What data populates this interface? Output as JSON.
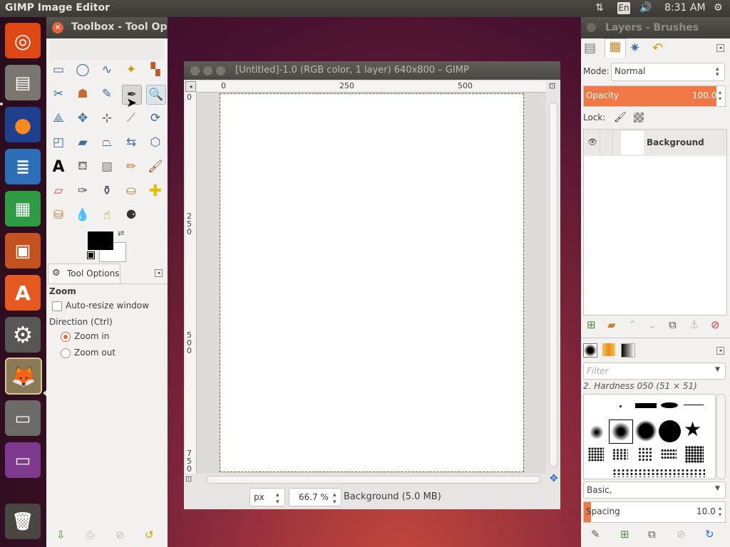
{
  "topbar": {
    "title": "GIMP Image Editor",
    "lang": "En",
    "time": "8:31 AM"
  },
  "toolbox": {
    "title": "Toolbox - Tool Op",
    "tool_options_tab": "Tool Options",
    "section": "Zoom",
    "auto_resize": "Auto-resize window",
    "direction": "Direction  (Ctrl)",
    "zoom_in": "Zoom in",
    "zoom_out": "Zoom out"
  },
  "image_window": {
    "title": "[Untitled]-1.0 (RGB color, 1 layer) 640x800 – GIMP",
    "ruler_top": [
      "0",
      "250",
      "500"
    ],
    "ruler_left": [
      "0",
      "2\n5\n0",
      "5\n0\n0",
      "7\n5\n0"
    ],
    "unit": "px",
    "zoom": "66.7 %",
    "status": "Background (5.0 MB)"
  },
  "dock": {
    "title": "Layers - Brushes",
    "mode_label": "Mode:",
    "mode_value": "Normal",
    "opacity_label": "Opacity",
    "opacity_value": "100.0",
    "lock_label": "Lock:",
    "layer_name": "Background",
    "filter_placeholder": "Filter",
    "brush_name": "2. Hardness 050 (51 × 51)",
    "brush_set": "Basic,",
    "spacing_label": "Spacing",
    "spacing_value": "10.0"
  },
  "colors": {
    "accent": "#f07746",
    "fg": "#000000",
    "bg": "#ffffff"
  }
}
